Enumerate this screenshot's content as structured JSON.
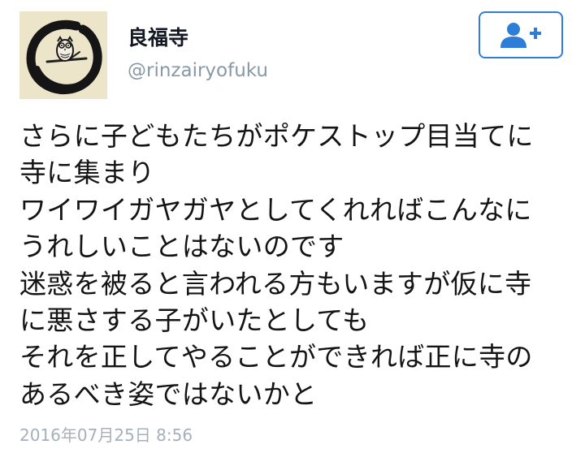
{
  "user": {
    "display_name": "良福寺",
    "handle": "@rinzairyofuku",
    "avatar_icon": "owl-enso-avatar-icon"
  },
  "follow_button": {
    "icon": "add-user-icon",
    "color": "#2e7dd6"
  },
  "tweet": {
    "lines": [
      "さらに子どもたちがポケストップ目当てに",
      "寺に集まり",
      "ワイワイガヤガヤとしてくれればこんなに",
      "うれしいことはないのです",
      "迷惑を被ると言われる方もいますが仮に寺",
      "に悪さする子がいたとしても",
      "それを正してやることができれば正に寺の",
      "あるべき姿ではないかと"
    ],
    "timestamp": "2016年07月25日 8:56"
  }
}
